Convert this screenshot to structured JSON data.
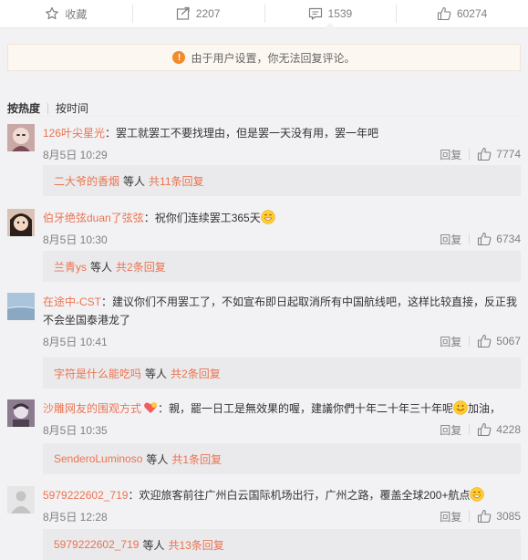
{
  "actions": [
    {
      "icon": "star-icon",
      "label": "收藏"
    },
    {
      "icon": "share-icon",
      "label": "2207"
    },
    {
      "icon": "comment-icon",
      "label": "1539"
    },
    {
      "icon": "thumbs-up-icon",
      "label": "60274"
    }
  ],
  "notice": {
    "text": "由于用户设置，你无法回复评论。"
  },
  "sort": {
    "hot": "按热度",
    "time": "按时间"
  },
  "reply_label": "回复",
  "comments": [
    {
      "user": "126叶尖星光",
      "text": "：罢工就罢工不要找理由，但是罢一天没有用，罢一年吧",
      "time": "8月5日 10:29",
      "likes": "7774",
      "sub_user": "二大爷的香烟",
      "sub_mid": "等人",
      "sub_count": "共11条回复"
    },
    {
      "user": "伯牙绝弦duan了弦弦",
      "text": "：祝你们连续罢工365天",
      "time": "8月5日 10:30",
      "likes": "6734",
      "sub_user": "兰青ys",
      "sub_mid": "等人",
      "sub_count": "共2条回复"
    },
    {
      "user": "在途中-CST",
      "text": "：建议你们不用罢工了，不如宣布即日起取消所有中国航线吧，这样比较直接，反正我不会坐国泰港龙了",
      "time": "8月5日 10:41",
      "likes": "5067",
      "sub_user": "字符是什么能吃吗",
      "sub_mid": "等人",
      "sub_count": "共2条回复"
    },
    {
      "user": "沙雕网友的围观方式",
      "text_a": "：親，罷一日工是無效果的喔，建議你們十年二十年三十年呢",
      "text_b": "加油，",
      "time": "8月5日 10:35",
      "likes": "4228",
      "sub_user": "SenderoLuminoso",
      "sub_mid": "等人",
      "sub_count": "共1条回复"
    },
    {
      "user": "5979222602_719",
      "text": "：欢迎旅客前往广州白云国际机场出行，广州之路，覆盖全球200+航点",
      "time": "8月5日 12:28",
      "likes": "3085",
      "sub_user": "5979222602_719",
      "sub_mid": "等人",
      "sub_count": "共13条回复"
    }
  ],
  "colors": {
    "accent": "#eb7350",
    "muted": "#808080",
    "panel": "#f2f2f5",
    "notice_icon": "#f28b2c"
  }
}
